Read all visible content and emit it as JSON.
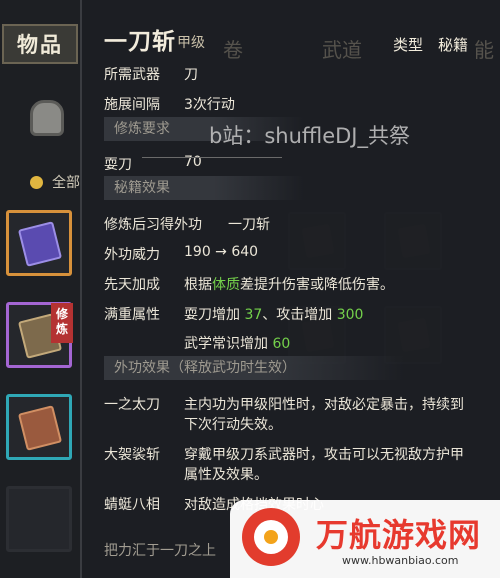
{
  "sidebar": {
    "tab_label": "物品",
    "filter_label": "全部",
    "slot_tag": "修炼"
  },
  "background": {
    "tab_1": "武道",
    "tab_2": "能"
  },
  "tooltip": {
    "title": "一刀斩",
    "grade": "甲级",
    "type_label": "类型",
    "type_value": "秘籍",
    "required_weapon_label": "所需武器",
    "required_weapon_value": "刀",
    "cast_interval_label": "施展间隔",
    "cast_interval_value": "3次行动",
    "section_requirement": "修炼要求",
    "skill_label": "耍刀",
    "skill_value": "70",
    "section_effects": "秘籍效果",
    "learn_label": "修炼后习得外功",
    "learn_value": "一刀斩",
    "power_label": "外功威力",
    "power_value": "190 → 640",
    "innate_label": "先天加成",
    "innate_prefix": "根据",
    "innate_highlight": "体质",
    "innate_suffix": "差提升伤害或降低伤害。",
    "mastery_label": "满重属性",
    "mastery_a_text": "耍刀增加",
    "mastery_a_value": "37",
    "mastery_b_text": "、攻击增加",
    "mastery_b_value": "300",
    "mastery_c_text": "武学常识增加",
    "mastery_c_value": "60",
    "section_external": "外功效果（释放武功时生效）",
    "effect1_label": "一之太刀",
    "effect1_line1": "主内功为甲级阳性时，对敌必定暴击，持续到",
    "effect1_line2": "下次行动失效。",
    "effect2_label": "大袈裟斩",
    "effect2_line1": "穿戴甲级刀系武器时，攻击可以无视敌方护甲",
    "effect2_line2": "属性及效果。",
    "effect3_label": "蜻蜓八相",
    "effect3_line1": "对敌造成格挡效果时心",
    "bottom_text": "把力汇于一刀之上"
  },
  "watermark": "b站：shuffleDJ_共祭",
  "logo": {
    "name": "万航游戏网",
    "url": "www.hbwanbiao.com",
    "color": "#e7392e"
  }
}
